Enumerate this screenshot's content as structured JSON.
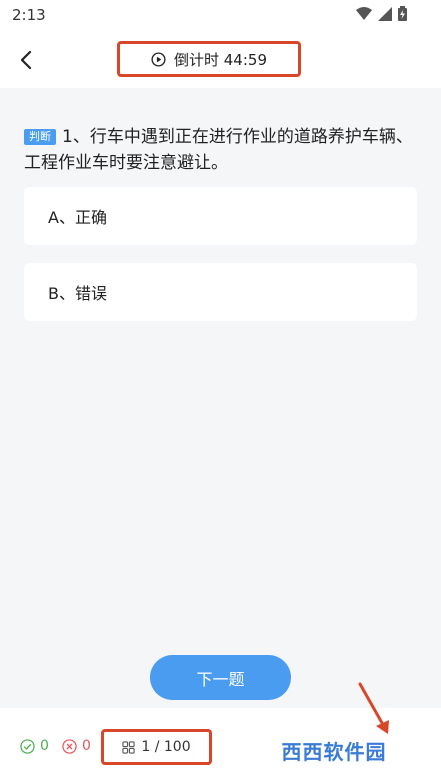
{
  "status_bar": {
    "time": "2:13"
  },
  "header": {
    "timer_text": "倒计时 44:59"
  },
  "question": {
    "type_badge": "判断",
    "text": "1、行车中遇到正在进行作业的道路养护车辆、工程作业车时要注意避让。",
    "options": [
      {
        "label": "A、正确"
      },
      {
        "label": "B、错误"
      }
    ]
  },
  "next_button": {
    "label": "下一题"
  },
  "bottom_bar": {
    "correct_count": "0",
    "wrong_count": "0",
    "progress": "1 / 100"
  },
  "watermark": {
    "text": "西西软件园"
  },
  "colors": {
    "accent": "#4a9cf0",
    "highlight_border": "#d9472b",
    "correct": "#4caf50",
    "wrong": "#e95555"
  }
}
